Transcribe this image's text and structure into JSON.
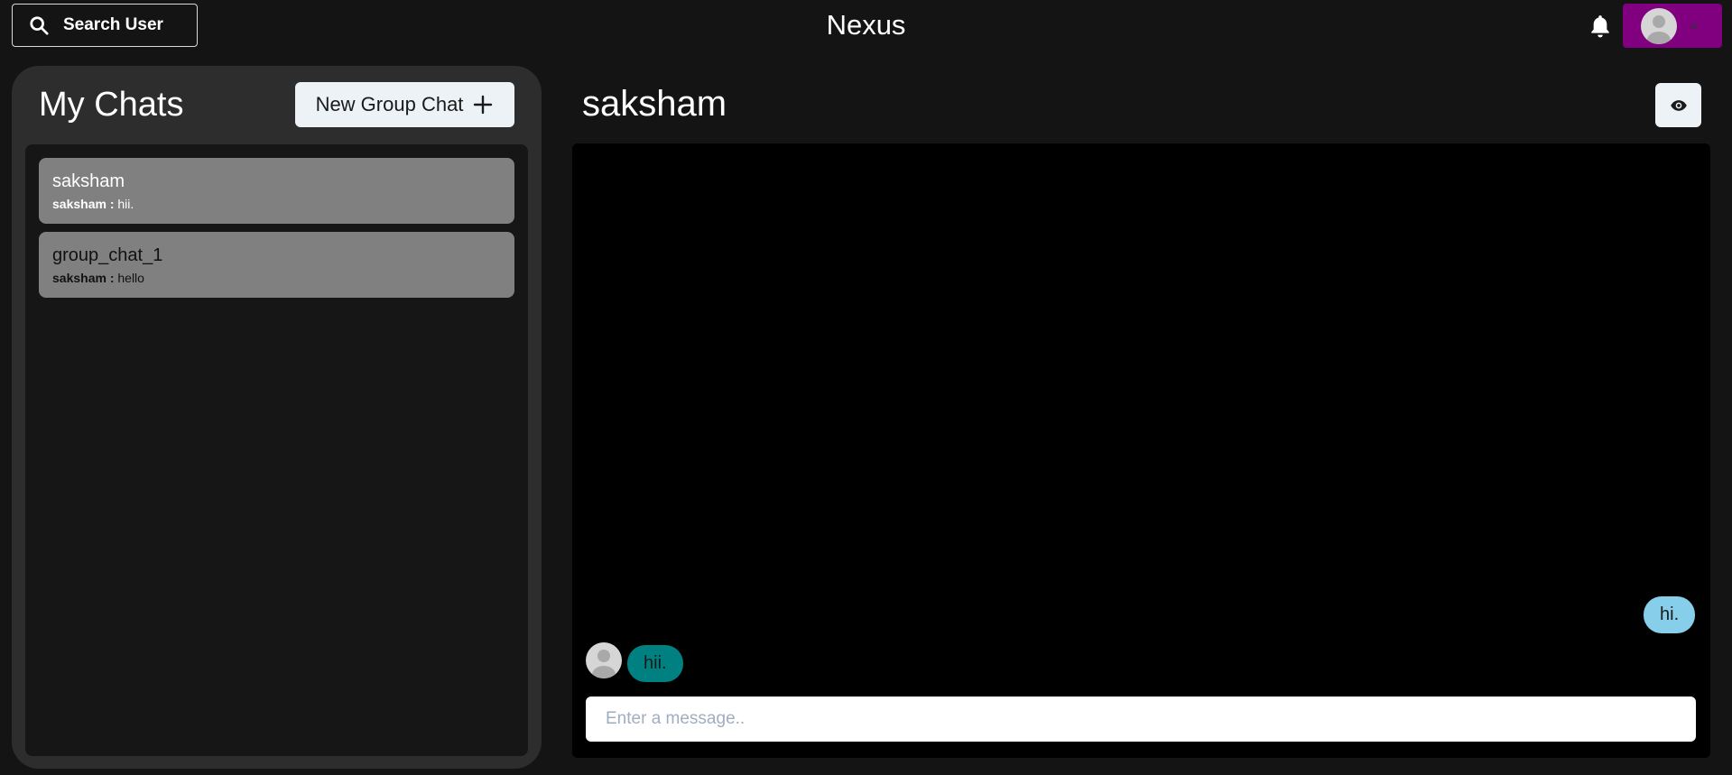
{
  "header": {
    "search_label": "Search User",
    "brand": "Nexus",
    "icons": {
      "search": "search-icon",
      "bell": "bell-icon",
      "avatar": "avatar-icon",
      "chevron": "chevron-down-icon"
    },
    "profile_bg": "#800080"
  },
  "sidebar": {
    "title": "My Chats",
    "new_group_label": "New Group Chat",
    "chats": [
      {
        "name": "saksham",
        "sender": "saksham :",
        "message": "hii."
      },
      {
        "name": "group_chat_1",
        "sender": "saksham :",
        "message": "hello"
      }
    ]
  },
  "chat": {
    "title": "saksham",
    "messages": [
      {
        "text": "hi.",
        "side": "right",
        "color": "#87ceeb"
      },
      {
        "text": "hii.",
        "side": "left",
        "color": "#008080"
      }
    ],
    "input_placeholder": "Enter a message.."
  }
}
